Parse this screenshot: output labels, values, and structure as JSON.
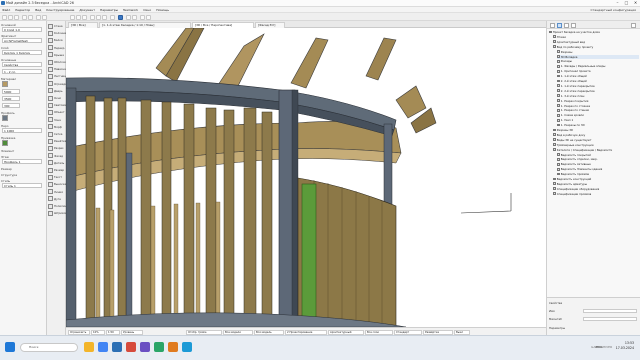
{
  "window": {
    "title": "Мой дизайн 2.3 беседка - ArchiCAD 26",
    "minimize": "–",
    "maximize": "□",
    "close": "✕"
  },
  "menu": {
    "items": [
      "Файл",
      "Редактор",
      "Вид",
      "Конструирование",
      "Документ",
      "Параметры",
      "Teamwork",
      "Окно",
      "Помощь"
    ],
    "right": "Стандартный конфигурация"
  },
  "toolbox": {
    "sections": [
      "Основной",
      "Фрагмент",
      "Слой",
      "Основные",
      "Материал",
      "Профиль",
      "Перо",
      "Привязка",
      "Элемент",
      "Этаж",
      "Размер",
      "Структура",
      "Стиль"
    ],
    "fields": [
      "0 Слой 1.0",
      "ArchiFrameMesh",
      "Кирпич 1 Кирпич",
      "Свойства",
      "1 - 2 сл.",
      "5000",
      "3500",
      "300",
      "1 1000",
      "Профиль 1",
      "Стиль 1"
    ]
  },
  "iconcol": {
    "items": [
      "Стена",
      "Колонна",
      "Балка",
      "Перекр.",
      "Крыша",
      "Оболочка",
      "Навесная",
      "Лестница",
      "Ограждение",
      "Дверь",
      "Окно",
      "Световой",
      "Объект",
      "Зона",
      "Морф",
      "Сетка",
      "Решётка",
      "Разрез",
      "Фасад",
      "Деталь",
      "Размер",
      "Текст",
      "Выноска",
      "Линия",
      "Дуга",
      "Полилиния",
      "Штриховка"
    ]
  },
  "tabs": [
    {
      "label": "[3D / Все]",
      "active": false
    },
    {
      "label": "[1. 1-й этаж беседка / 1:10 / План]",
      "active": false
    },
    {
      "label": "[3D / Все / Перспектива]",
      "active": true
    },
    {
      "label": "[Фасад Юг]",
      "active": false
    }
  ],
  "status": {
    "items": [
      "Ограничить",
      "10%",
      "1:50",
      "Уровень",
      "Отобр. трёхм.",
      "Все модели",
      "Вся модель",
      "2 Проектирование",
      "Архитектурный",
      "Все слои",
      "Стандарт",
      "Развёртка",
      "Выкл"
    ]
  },
  "navigator": {
    "tree": [
      {
        "label": "Проект беседка на участке дома",
        "indent": 0,
        "selected": false
      },
      {
        "label": "Этажи",
        "indent": 1,
        "selected": false
      },
      {
        "label": "Архитектурный вид",
        "indent": 1,
        "selected": false
      },
      {
        "label": "Вид по рабочему проекту",
        "indent": 1,
        "selected": false
      },
      {
        "label": "Разрезы",
        "indent": 2,
        "selected": false
      },
      {
        "label": "3D Вкладка",
        "indent": 2,
        "selected": true
      },
      {
        "label": "Фасады",
        "indent": 2,
        "selected": false
      },
      {
        "label": "1. Фасады / Радиальные эпюры",
        "indent": 2,
        "selected": false
      },
      {
        "label": "1. Оригинал проекта",
        "indent": 2,
        "selected": false
      },
      {
        "label": "1. 1-й этаж общий",
        "indent": 2,
        "selected": false
      },
      {
        "label": "2. 2-й этаж общий",
        "indent": 2,
        "selected": false
      },
      {
        "label": "1. 1-й этаж перекрытие",
        "indent": 2,
        "selected": false
      },
      {
        "label": "2. 2-й этаж перекрытие",
        "indent": 2,
        "selected": false
      },
      {
        "label": "1. 3-й этаж план",
        "indent": 2,
        "selected": false
      },
      {
        "label": "1. Разрез покрытия",
        "indent": 2,
        "selected": false
      },
      {
        "label": "1. Разрез по стоянке",
        "indent": 2,
        "selected": false
      },
      {
        "label": "1. Разрез по стенам",
        "indent": 2,
        "selected": false
      },
      {
        "label": "1. Схема кровли",
        "indent": 2,
        "selected": false
      },
      {
        "label": "1. Узел 1",
        "indent": 2,
        "selected": false
      },
      {
        "label": "1. Разрезы по 3D",
        "indent": 2,
        "selected": false
      },
      {
        "label": "Разрезы 3D",
        "indent": 1,
        "selected": false
      },
      {
        "label": "Вид в рабочую доку",
        "indent": 1,
        "selected": false
      },
      {
        "label": "Виды 3D не существуют",
        "indent": 1,
        "selected": false
      },
      {
        "label": "Трёхмерные конструкции",
        "indent": 1,
        "selected": false
      },
      {
        "label": "Каталоги / Спецификации / Ведомости",
        "indent": 1,
        "selected": false
      },
      {
        "label": "Ведомость покрытий",
        "indent": 2,
        "selected": false
      },
      {
        "label": "Ведомость отделки, закр.",
        "indent": 2,
        "selected": false
      },
      {
        "label": "Ведомость Активные",
        "indent": 2,
        "selected": false
      },
      {
        "label": "Ведомость Элементы здания",
        "indent": 2,
        "selected": false
      },
      {
        "label": "Ведомость проёмов",
        "indent": 2,
        "selected": false
      },
      {
        "label": "Ведомость конструкций",
        "indent": 1,
        "selected": false
      },
      {
        "label": "Ведомость арматуры",
        "indent": 1,
        "selected": false
      },
      {
        "label": "Спецификации оборудования",
        "indent": 1,
        "selected": false
      },
      {
        "label": "Спецификации проёмов",
        "indent": 1,
        "selected": false
      }
    ],
    "props": [
      {
        "label": "Свойства"
      },
      {
        "label": "Имя"
      },
      {
        "label": "Масштаб"
      },
      {
        "label": "Параметры"
      }
    ]
  },
  "taskbar": {
    "search": "Поиск",
    "lang": "ENG",
    "time": "13:53",
    "date": "17.03.2024"
  },
  "watermark": "GAMEINHIVER"
}
